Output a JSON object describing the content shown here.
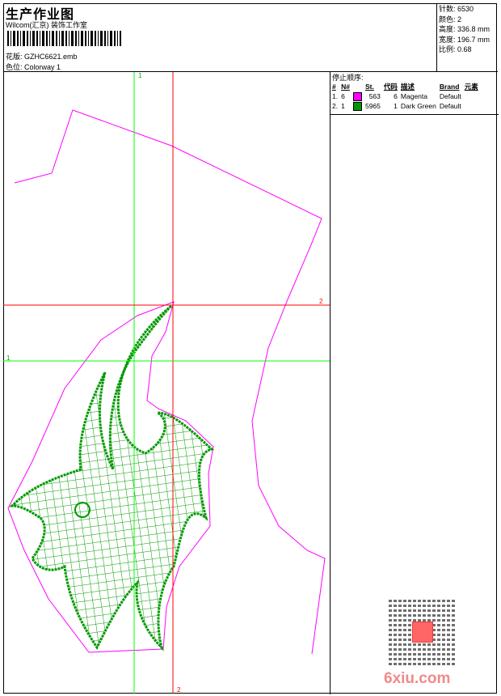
{
  "header": {
    "title": "生产作业图",
    "company": "Wilcom(汇京) 装饰工作室",
    "design_label": "花版:",
    "design_value": "GZHC6621.emb",
    "colorway_label": "色位:",
    "colorway_value": "Colorway 1"
  },
  "info": [
    {
      "label": "针数:",
      "value": "6530"
    },
    {
      "label": "颜色:",
      "value": "2"
    },
    {
      "label": "高度:",
      "value": "336.8 mm"
    },
    {
      "label": "宽度:",
      "value": "196.7 mm"
    },
    {
      "label": "比例:",
      "value": "0.68"
    }
  ],
  "stop_sequence": {
    "title": "停止顺序:",
    "columns": [
      "#",
      "N#",
      "",
      "St.",
      "代码",
      "描述",
      "Brand",
      "元素"
    ],
    "rows": [
      {
        "num": "1.",
        "n": "6",
        "color": "#ff00ff",
        "st": "563",
        "code": "6",
        "desc": "Magenta",
        "brand": "Default"
      },
      {
        "num": "2.",
        "n": "1",
        "color": "#009900",
        "st": "5965",
        "code": "1",
        "desc": "Dark Green",
        "brand": "Default"
      }
    ]
  },
  "guides": {
    "green_v": "1",
    "red_h": "2",
    "green_h": "1",
    "red_v": "2"
  },
  "watermark": "6xiu.com",
  "colors": {
    "magenta": "#ff00ff",
    "green": "#009900",
    "guide_green": "#00ff00",
    "guide_red": "#ff0000"
  }
}
